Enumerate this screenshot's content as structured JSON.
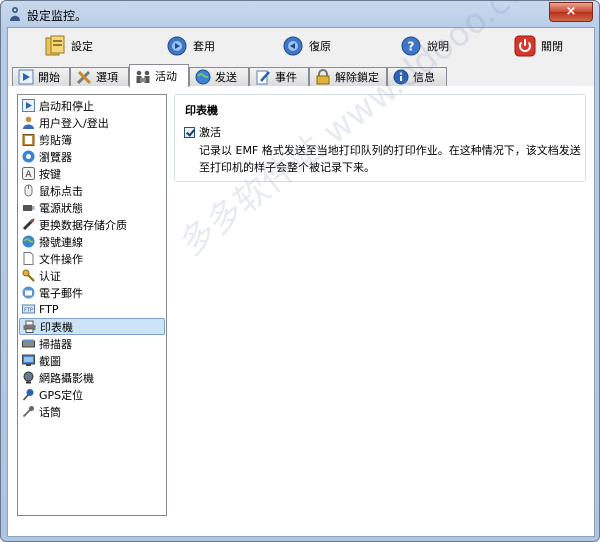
{
  "window": {
    "title": "設定监控。",
    "close_glyph": "×"
  },
  "toolbar": {
    "settings_label": "設定",
    "apply_label": "套用",
    "restore_label": "復原",
    "help_label": "說明",
    "close_label": "關閉"
  },
  "tabs": [
    {
      "label": "開始"
    },
    {
      "label": "選項"
    },
    {
      "label": "活动"
    },
    {
      "label": "发送"
    },
    {
      "label": "事件"
    },
    {
      "label": "解除鎖定"
    },
    {
      "label": "信息"
    }
  ],
  "sidebar": {
    "items": [
      {
        "label": "启动和停止"
      },
      {
        "label": "用户登入/登出"
      },
      {
        "label": "剪貼簿"
      },
      {
        "label": "瀏覽器"
      },
      {
        "label": "按键"
      },
      {
        "label": "鼠标点击"
      },
      {
        "label": "電源狀態"
      },
      {
        "label": "更换数据存储介质"
      },
      {
        "label": "撥號連線"
      },
      {
        "label": "文件操作"
      },
      {
        "label": "认证"
      },
      {
        "label": "電子郵件"
      },
      {
        "label": "FTP"
      },
      {
        "label": "印表機"
      },
      {
        "label": "掃描器"
      },
      {
        "label": "截圖"
      },
      {
        "label": "網路攝影機"
      },
      {
        "label": "GPS定位"
      },
      {
        "label": "话筒"
      }
    ],
    "selected_index": 13
  },
  "printer_group": {
    "title": "印表機",
    "checkbox_label": "激活",
    "checked": true,
    "description": "记录以 EMF 格式发送至当地打印队列的打印作业。在这种情况下，该文档发送至打印机的样子会整个被记录下来。"
  },
  "watermark_text": "多多软件站 www.ddooo.com"
}
